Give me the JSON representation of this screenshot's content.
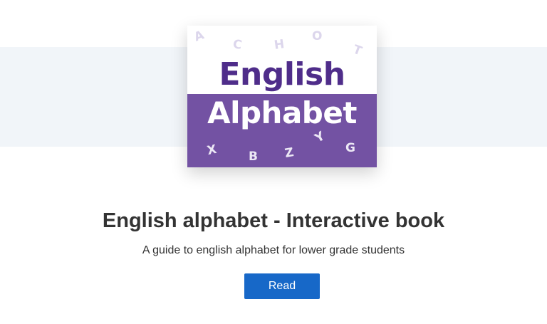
{
  "book": {
    "cover": {
      "line1": "English",
      "line2": "Alphabet",
      "letters_top": [
        "A",
        "C",
        "H",
        "O",
        "T"
      ],
      "letters_bottom": [
        "X",
        "B",
        "Z",
        "Y",
        "G"
      ],
      "colors": {
        "purple_dark": "#4f2d8a",
        "purple_panel": "#7352a3"
      }
    },
    "title": "English alphabet - Interactive book",
    "description": "A guide to english alphabet for lower grade students",
    "read_label": "Read"
  },
  "colors": {
    "band": "#f1f5f9",
    "button": "#1768c8",
    "text": "#333333"
  }
}
